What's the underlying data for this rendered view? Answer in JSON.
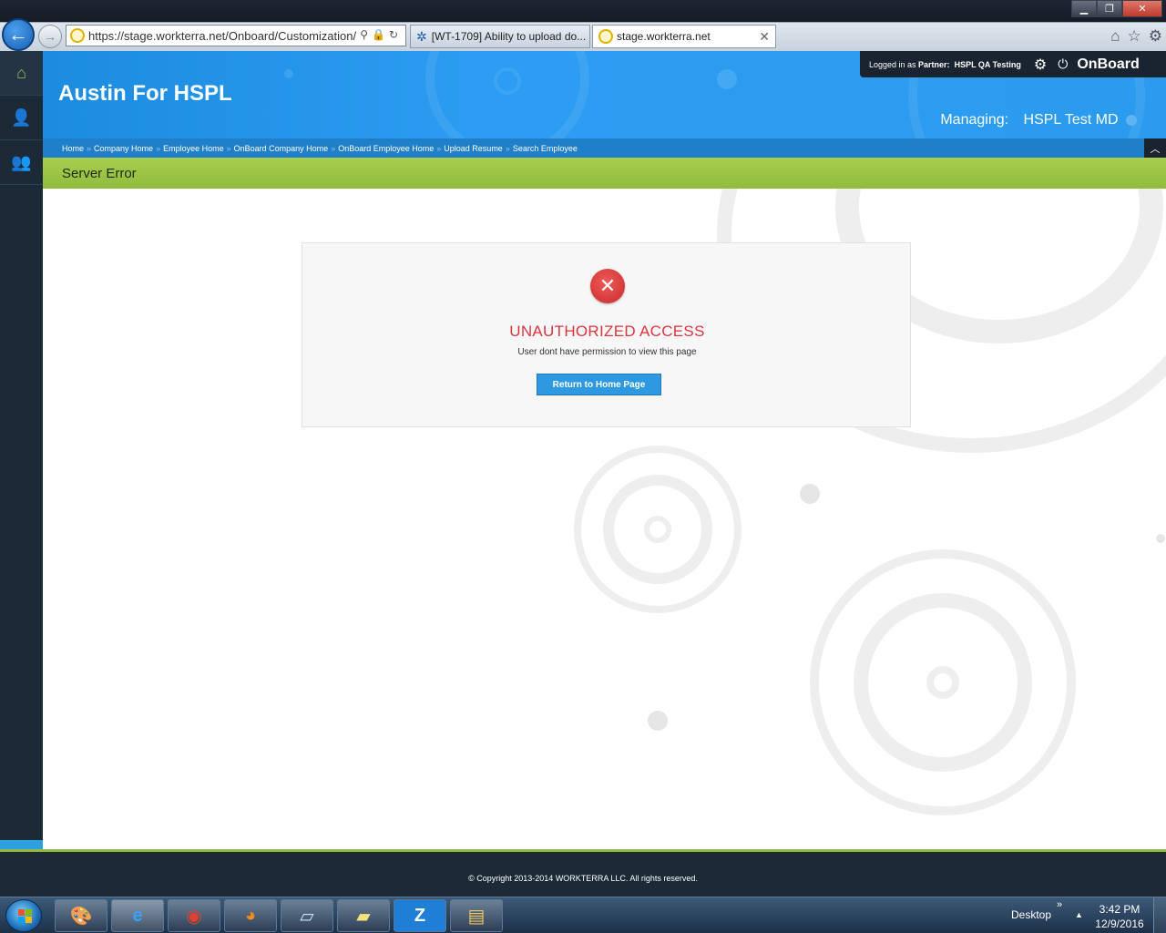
{
  "browser": {
    "url": "https://stage.workterra.net/Onboard/Customization/",
    "tabs": [
      {
        "label": "[WT-1709] Ability to upload do..."
      },
      {
        "label": "stage.workterra.net"
      }
    ]
  },
  "header": {
    "brand_title": "Austin For HSPL",
    "login_prefix": "Logged in as ",
    "login_role": "Partner:",
    "login_name": "HSPL QA Testing",
    "app_name": "OnBoard",
    "managing_label": "Managing:",
    "managing_value": "HSPL Test MD"
  },
  "breadcrumb": [
    {
      "label": "Home"
    },
    {
      "label": "Company Home"
    },
    {
      "label": "Employee Home"
    },
    {
      "label": "OnBoard Company Home"
    },
    {
      "label": "OnBoard Employee Home"
    },
    {
      "label": "Upload Resume"
    },
    {
      "label": "Search Employee"
    }
  ],
  "breadcrumb_sep": "»",
  "page": {
    "title": "Server Error"
  },
  "error": {
    "title": "UNAUTHORIZED ACCESS",
    "message": "User dont have permission to view this page",
    "button_label": "Return to Home Page"
  },
  "footer": {
    "copyright": "© Copyright 2013-2014 WORKTERRA LLC. All rights reserved."
  },
  "taskbar": {
    "desktop_label": "Desktop",
    "time": "3:42 PM",
    "date": "12/9/2016"
  },
  "colors": {
    "header_blue": "#2c9df2",
    "nav_dark": "#1c2a38",
    "accent_green": "#8fbc3d",
    "error_red": "#d9363e",
    "button_blue": "#2e98e0"
  }
}
